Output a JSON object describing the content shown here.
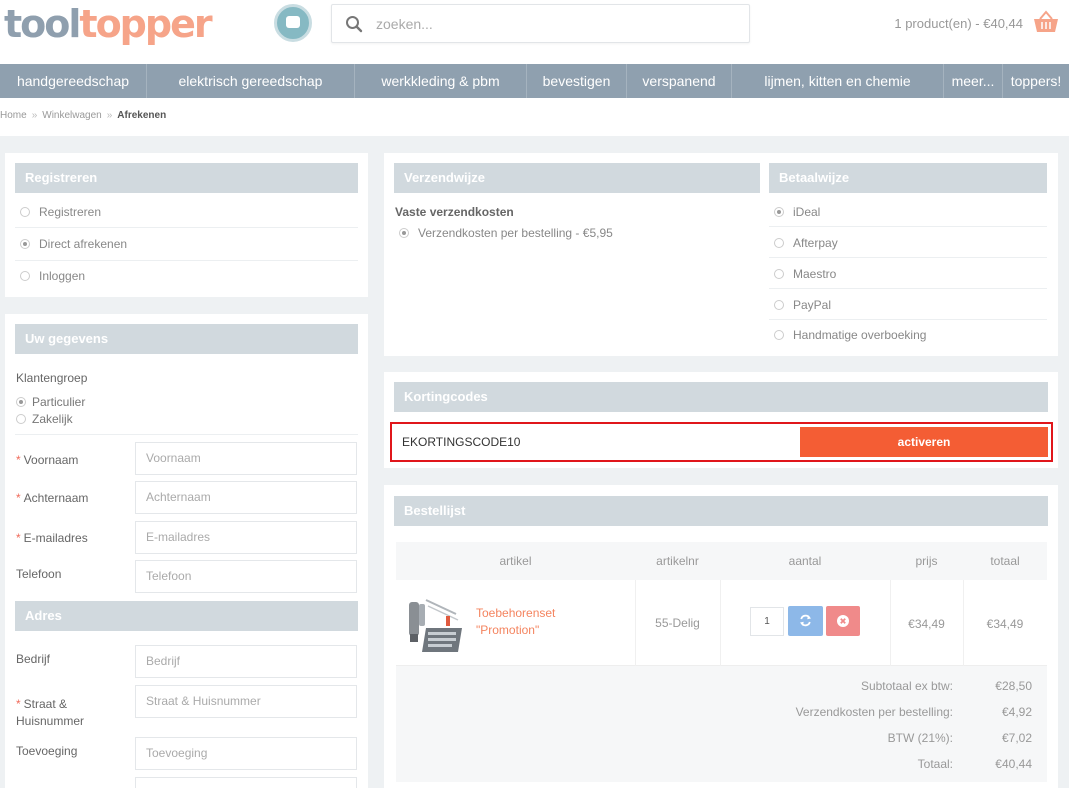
{
  "header": {
    "logo_part1": "tool",
    "logo_part2": "topper",
    "search_placeholder": "zoeken...",
    "cart_summary": "1 product(en) - €40,44"
  },
  "nav": {
    "items": [
      "handgereedschap",
      "elektrisch gereedschap",
      "werkkleding & pbm",
      "bevestigen",
      "verspanend",
      "lijmen, kitten en chemie",
      "meer...",
      "toppers!"
    ]
  },
  "breadcrumb": {
    "home": "Home",
    "cart": "Winkelwagen",
    "current": "Afrekenen",
    "separator": "»"
  },
  "register": {
    "title": "Registreren",
    "options": [
      "Registreren",
      "Direct afrekenen",
      "Inloggen"
    ],
    "selected": 1
  },
  "details": {
    "title": "Uw gegevens",
    "customer_group_label": "Klantengroep",
    "groups": [
      "Particulier",
      "Zakelijk"
    ],
    "fields": {
      "firstname": {
        "label": "Voornaam",
        "placeholder": "Voornaam",
        "required": "*"
      },
      "lastname": {
        "label": "Achternaam",
        "placeholder": "Achternaam",
        "required": "*"
      },
      "email": {
        "label": "E-mailadres",
        "placeholder": "E-mailadres",
        "required": "*"
      },
      "phone": {
        "label": "Telefoon",
        "placeholder": "Telefoon"
      }
    }
  },
  "address": {
    "title": "Adres",
    "fields": {
      "company": {
        "label": "Bedrijf",
        "placeholder": "Bedrijf"
      },
      "street": {
        "label_line1": "Straat &",
        "label_line2": "Huisnummer",
        "placeholder": "Straat & Huisnummer",
        "required": "*"
      },
      "addition": {
        "label": "Toevoeging",
        "placeholder": "Toevoeging"
      }
    }
  },
  "shipping": {
    "title": "Verzendwijze",
    "subtitle": "Vaste verzendkosten",
    "option": "Verzendkosten per bestelling - €5,95"
  },
  "payment": {
    "title": "Betaalwijze",
    "options": [
      "iDeal",
      "Afterpay",
      "Maestro",
      "PayPal",
      "Handmatige overboeking"
    ],
    "selected": 0
  },
  "coupon": {
    "title": "Kortingcodes",
    "code": "EKORTINGSCODE10",
    "button": "activeren"
  },
  "order": {
    "title": "Bestellijst",
    "columns": [
      "artikel",
      "artikelnr",
      "aantal",
      "prijs",
      "totaal"
    ],
    "item": {
      "name_line1": "Toebehorenset",
      "name_line2": "\"Promotion\"",
      "sku": "55-Delig",
      "qty": "1",
      "price": "€34,49",
      "total": "€34,49"
    },
    "totals": [
      {
        "label": "Subtotaal ex btw:",
        "value": "€28,50"
      },
      {
        "label": "Verzendkosten per bestelling:",
        "value": "€4,92"
      },
      {
        "label": "BTW (21%):",
        "value": "€7,02"
      },
      {
        "label": "Totaal:",
        "value": "€40,44"
      }
    ]
  },
  "colors": {
    "accent": "#f45d34",
    "nav": "#8fa0af",
    "panel_head": "#d1d9de",
    "highlight_border": "#e0161b"
  }
}
